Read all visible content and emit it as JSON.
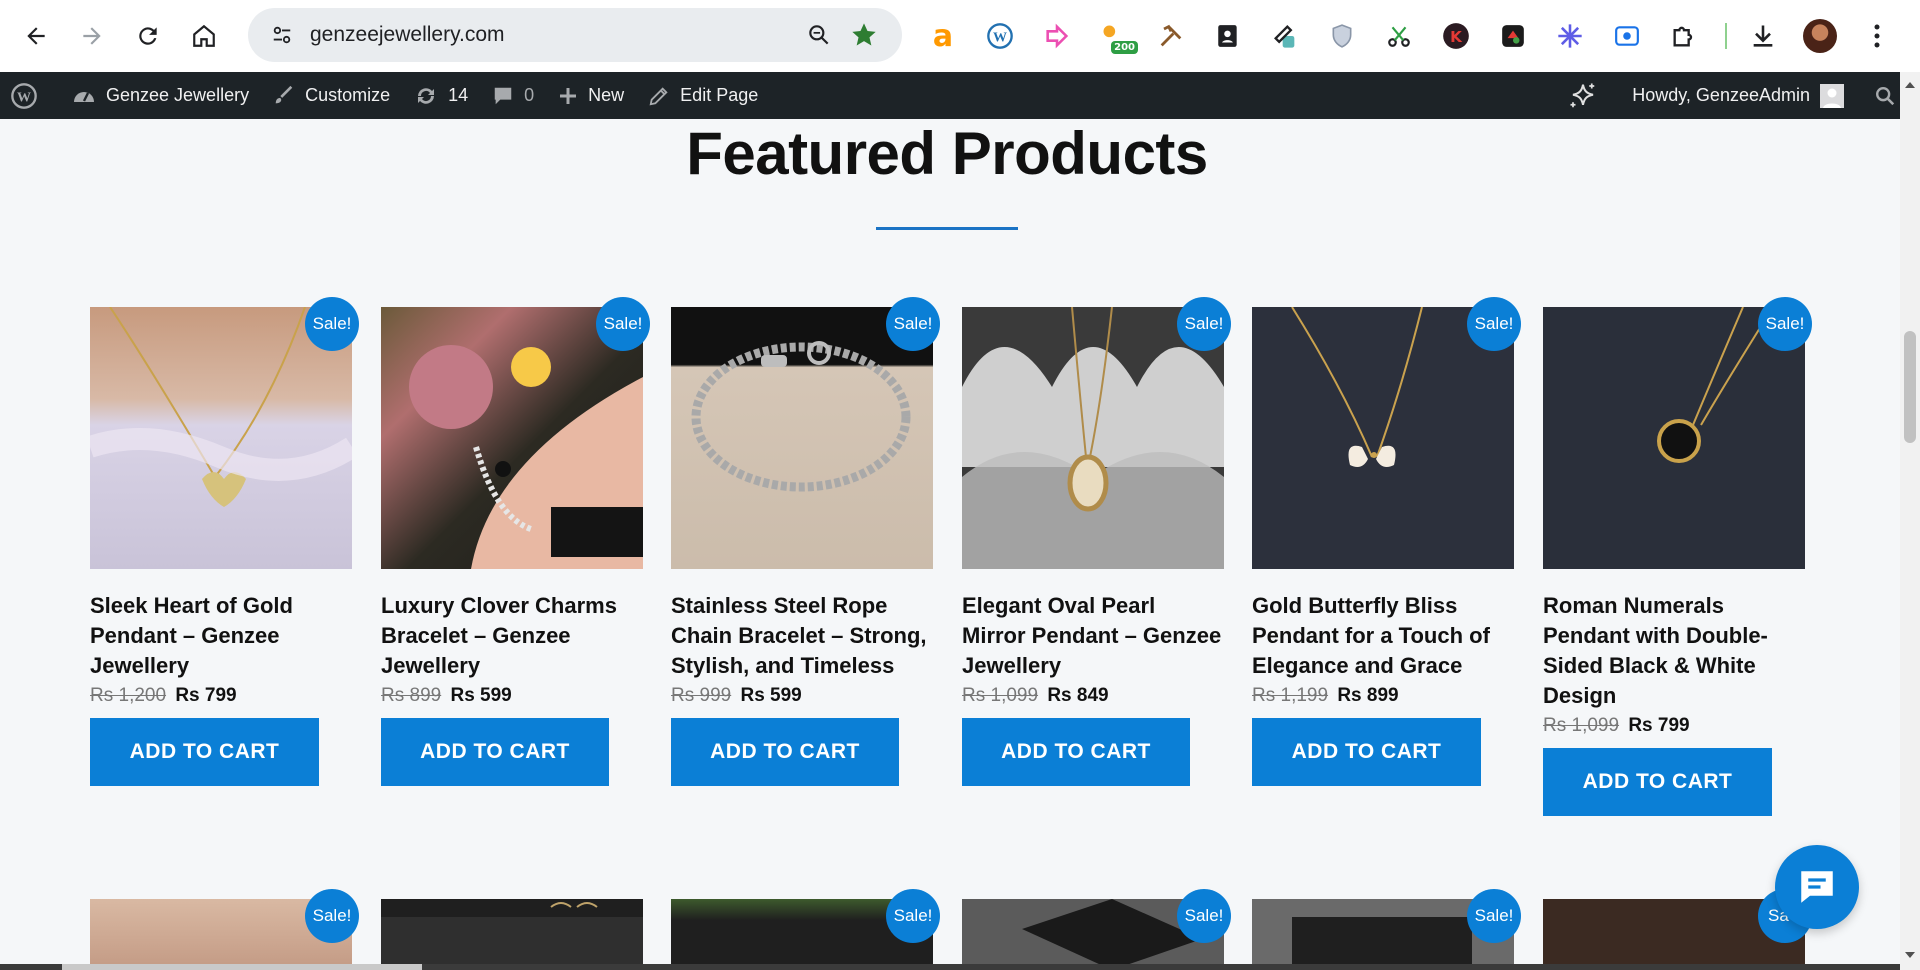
{
  "browser": {
    "url": "genzeejewellery.com",
    "extension_badge": "200"
  },
  "admin_bar": {
    "site_name": "Genzee Jewellery",
    "customize": "Customize",
    "updates_count": "14",
    "comments_count": "0",
    "new_label": "New",
    "edit_page": "Edit Page",
    "howdy": "Howdy, GenzeeAdmin"
  },
  "section": {
    "title": "Featured Products"
  },
  "sale_label": "Sale!",
  "sale_label_partial": "Sa",
  "products": [
    {
      "name": "Sleek Heart of Gold Pendant – Genzee Jewellery",
      "old_price": "Rs 1,200",
      "new_price": "Rs 799",
      "button": "ADD TO CART"
    },
    {
      "name": "Luxury Clover Charms Bracelet – Genzee Jewellery",
      "old_price": "Rs 899",
      "new_price": "Rs 599",
      "button": "ADD TO CART"
    },
    {
      "name": "Stainless Steel Rope Chain Bracelet – Strong, Stylish, and Timeless",
      "old_price": "Rs 999",
      "new_price": "Rs 599",
      "button": "ADD TO CART"
    },
    {
      "name": "Elegant Oval Pearl Mirror Pendant – Genzee Jewellery",
      "old_price": "Rs 1,099",
      "new_price": "Rs 849",
      "button": "ADD TO CART"
    },
    {
      "name": "Gold Butterfly Bliss Pendant for a Touch of Elegance and Grace",
      "old_price": "Rs 1,199",
      "new_price": "Rs 899",
      "button": "ADD TO CART"
    },
    {
      "name": "Roman Numerals Pendant with Double-Sided Black & White Design",
      "old_price": "Rs 1,099",
      "new_price": "Rs 799",
      "button": "ADD TO CART"
    }
  ],
  "colors": {
    "accent": "#0b7fd6",
    "admin_bar": "#1d2327"
  }
}
